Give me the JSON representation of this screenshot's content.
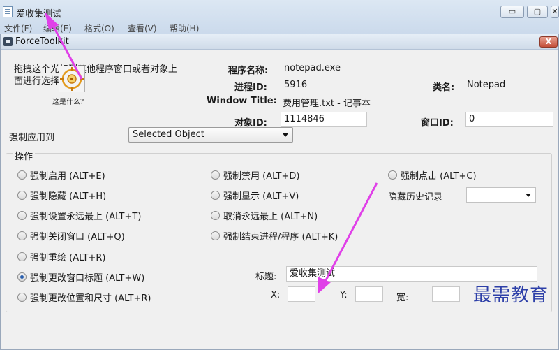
{
  "notepad": {
    "title": "爱收集测试",
    "controls": [
      "▭",
      "▢",
      "✕"
    ],
    "menu": [
      "文件(F)",
      "编辑(E)",
      "格式(O)",
      "查看(V)",
      "帮助(H)"
    ]
  },
  "dialog": {
    "title": "ForceToolkit",
    "close": "X"
  },
  "instruction": "拖拽这个光标到其他程序窗口或者对象上面进行选择:",
  "what_is_link": "这是什么？",
  "info": {
    "program_name_label": "程序名称:",
    "program_name": "notepad.exe",
    "process_id_label": "进程ID:",
    "process_id": "5916",
    "class_label": "类名:",
    "class_name": "Notepad",
    "window_title_label": "Window Title:",
    "window_title": "费用管理.txt - 记事本",
    "object_id_label": "对象ID:",
    "object_id": "1114846",
    "window_id_label": "窗口ID:",
    "window_id": "0"
  },
  "apply_to": {
    "label": "强制应用到",
    "selected": "Selected Object"
  },
  "operations": {
    "legend": "操作",
    "col1": [
      {
        "label": "强制启用 (ALT+E)",
        "checked": false
      },
      {
        "label": "强制隐藏 (ALT+H)",
        "checked": false
      },
      {
        "label": "强制设置永远最上 (ALT+T)",
        "checked": false
      },
      {
        "label": "强制关闭窗口 (ALT+Q)",
        "checked": false
      },
      {
        "label": "强制重绘 (ALT+R)",
        "checked": false
      },
      {
        "label": "强制更改窗口标题 (ALT+W)",
        "checked": true
      },
      {
        "label": "强制更改位置和尺寸 (ALT+R)",
        "checked": false
      }
    ],
    "col2": [
      {
        "label": "强制禁用 (ALT+D)",
        "checked": false
      },
      {
        "label": "强制显示 (ALT+V)",
        "checked": false
      },
      {
        "label": "取消永远最上 (ALT+N)",
        "checked": false
      },
      {
        "label": "强制结束进程/程序 (ALT+K)",
        "checked": false
      }
    ],
    "col3_click": {
      "label": "强制点击 (ALT+C)",
      "checked": false
    },
    "history_label": "隐藏历史记录",
    "history_value": "",
    "title_field_label": "标题:",
    "title_field_value": "爱收集测试",
    "x_label": "X:",
    "y_label": "Y:",
    "w_label": "宽:",
    "x_value": "",
    "y_value": "",
    "w_value": ""
  },
  "watermark": "最需教育",
  "colors": {
    "annotation_arrow": "#e040e8",
    "watermark": "#2d3fa8",
    "titlebar": "#cfdbe9",
    "close_button": "#c4503a"
  }
}
